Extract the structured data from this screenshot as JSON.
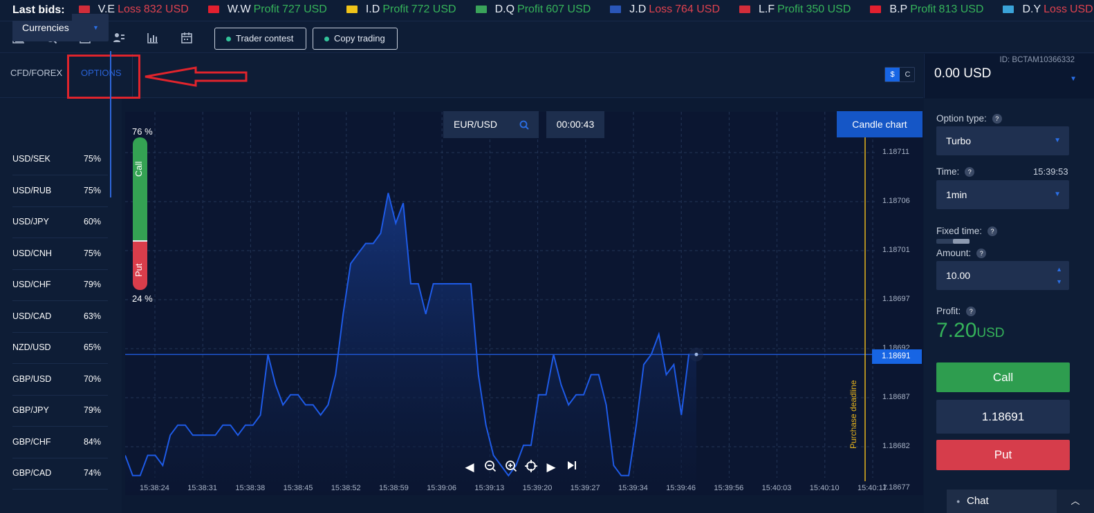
{
  "ticker": {
    "label": "Last bids:",
    "items": [
      {
        "code": "",
        "kind": "",
        "amount": "USD",
        "cls": "loss",
        "flag": "#cc3344"
      },
      {
        "code": "V.E",
        "kind": "Loss",
        "amount": "832 USD",
        "cls": "loss",
        "flag": "#d12d3a"
      },
      {
        "code": "W.W",
        "kind": "Profit",
        "amount": "727 USD",
        "cls": "profit",
        "flag": "#e2202f"
      },
      {
        "code": "I.D",
        "kind": "Profit",
        "amount": "772 USD",
        "cls": "profit",
        "flag": "#f0c419"
      },
      {
        "code": "D.Q",
        "kind": "Profit",
        "amount": "607 USD",
        "cls": "profit",
        "flag": "#3aa35a"
      },
      {
        "code": "J.D",
        "kind": "Loss",
        "amount": "764 USD",
        "cls": "loss",
        "flag": "#2a56b8"
      },
      {
        "code": "L.F",
        "kind": "Profit",
        "amount": "350 USD",
        "cls": "profit",
        "flag": "#d12d3a"
      },
      {
        "code": "B.P",
        "kind": "Profit",
        "amount": "813 USD",
        "cls": "profit",
        "flag": "#e2202f"
      },
      {
        "code": "D.Y",
        "kind": "Loss",
        "amount": "USD",
        "cls": "loss",
        "flag": "#3aa3d8"
      }
    ]
  },
  "toolbar": {
    "trader_contest": "Trader contest",
    "copy_trading": "Copy trading"
  },
  "tabs": {
    "cfd": "CFD/FOREX",
    "options": "OPTIONS"
  },
  "currency_toggle": {
    "usd": "$",
    "other": "C"
  },
  "account": {
    "id": "ID: BCTAM10366332",
    "balance": "0.00 USD"
  },
  "left": {
    "category": "Currencies",
    "pairs": [
      {
        "name": "USD/SEK",
        "pct": "75%"
      },
      {
        "name": "USD/RUB",
        "pct": "75%"
      },
      {
        "name": "USD/JPY",
        "pct": "60%"
      },
      {
        "name": "USD/CNH",
        "pct": "75%"
      },
      {
        "name": "USD/CHF",
        "pct": "79%"
      },
      {
        "name": "USD/CAD",
        "pct": "63%"
      },
      {
        "name": "NZD/USD",
        "pct": "65%"
      },
      {
        "name": "GBP/USD",
        "pct": "70%"
      },
      {
        "name": "GBP/JPY",
        "pct": "79%"
      },
      {
        "name": "GBP/CHF",
        "pct": "84%"
      },
      {
        "name": "GBP/CAD",
        "pct": "74%"
      }
    ]
  },
  "chart": {
    "pair": "EUR/USD",
    "timer": "00:00:43",
    "candle_button": "Candle chart",
    "call_pct": "76 %",
    "put_pct": "24 %",
    "call_label": "Call",
    "put_label": "Put",
    "current_price": "1.18691",
    "deadline_label": "Purchase deadline",
    "colors": {
      "line": "#1e5be8",
      "deadline": "#e8b51c",
      "call": "#34a253",
      "put": "#d93d4b"
    }
  },
  "chart_data": {
    "type": "area",
    "title": "",
    "xlabel": "",
    "ylabel": "",
    "x_ticks": [
      "15:38:24",
      "15:38:31",
      "15:38:38",
      "15:38:45",
      "15:38:52",
      "15:38:59",
      "15:39:06",
      "15:39:13",
      "15:39:20",
      "15:39:27",
      "15:39:34",
      "15:39:46",
      "15:39:56",
      "15:40:03",
      "15:40:10",
      "15:40:17"
    ],
    "y_ticks": [
      "1.18711",
      "1.18706",
      "1.18701",
      "1.18697",
      "1.18692",
      "1.18687",
      "1.18682",
      "1.18677"
    ],
    "ylim": [
      1.186775,
      1.18711
    ],
    "grid": true,
    "series": [
      {
        "values": [
          1.18681,
          1.18679,
          1.18679,
          1.18681,
          1.18681,
          1.1868,
          1.18683,
          1.18684,
          1.18684,
          1.18683,
          1.18683,
          1.18683,
          1.18683,
          1.18684,
          1.18684,
          1.18683,
          1.18684,
          1.18684,
          1.18685,
          1.18691,
          1.18688,
          1.18686,
          1.18687,
          1.18687,
          1.18686,
          1.18686,
          1.18685,
          1.18686,
          1.18689,
          1.18695,
          1.187,
          1.18701,
          1.18702,
          1.18702,
          1.18703,
          1.18707,
          1.18704,
          1.18706,
          1.18698,
          1.18698,
          1.18695,
          1.18698,
          1.18698,
          1.18698,
          1.18698,
          1.18698,
          1.18698,
          1.18689,
          1.18684,
          1.18681,
          1.1868,
          1.18679,
          1.1868,
          1.18682,
          1.18682,
          1.18687,
          1.18687,
          1.18691,
          1.18688,
          1.18686,
          1.18687,
          1.18687,
          1.18689,
          1.18689,
          1.18686,
          1.1868,
          1.18679,
          1.18679,
          1.18684,
          1.1869,
          1.18691,
          1.18693,
          1.18689,
          1.1869,
          1.18685,
          1.18691,
          1.18691
        ]
      }
    ]
  },
  "right": {
    "option_type_label": "Option type:",
    "option_type": "Turbo",
    "time_label": "Time:",
    "time_value": "15:39:53",
    "duration": "1min",
    "fixed_time_label": "Fixed time:",
    "amount_label": "Amount:",
    "amount": "10.00",
    "profit_label": "Profit:",
    "profit_value": "7.20",
    "profit_currency": "USD",
    "call": "Call",
    "price": "1.18691",
    "put": "Put"
  },
  "chat": {
    "label": "Chat"
  }
}
